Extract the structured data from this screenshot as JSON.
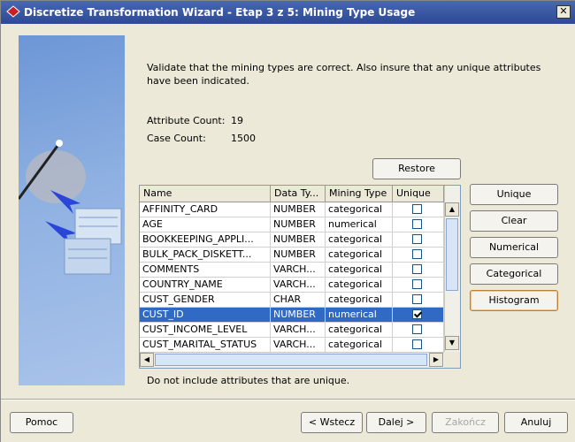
{
  "window": {
    "title": "Discretize Transformation Wizard - Etap 3 z 5: Mining Type Usage",
    "close_glyph": "✕"
  },
  "description": "Validate that the mining types are correct.  Also insure that any unique attributes have been indicated.",
  "counts": {
    "attribute_label": "Attribute Count:",
    "attribute_value": "19",
    "case_label": "Case Count:",
    "case_value": "1500"
  },
  "restore_button": "Restore",
  "table": {
    "columns": [
      "Name",
      "Data Ty...",
      "Mining Type",
      "Unique"
    ],
    "rows": [
      {
        "name": "AFFINITY_CARD",
        "type": "NUMBER",
        "mining": "categorical",
        "unique": false
      },
      {
        "name": "AGE",
        "type": "NUMBER",
        "mining": "numerical",
        "unique": false
      },
      {
        "name": "BOOKKEEPING_APPLI...",
        "type": "NUMBER",
        "mining": "categorical",
        "unique": false
      },
      {
        "name": "BULK_PACK_DISKETT...",
        "type": "NUMBER",
        "mining": "categorical",
        "unique": false
      },
      {
        "name": "COMMENTS",
        "type": "VARCH...",
        "mining": "categorical",
        "unique": false
      },
      {
        "name": "COUNTRY_NAME",
        "type": "VARCH...",
        "mining": "categorical",
        "unique": false
      },
      {
        "name": "CUST_GENDER",
        "type": "CHAR",
        "mining": "categorical",
        "unique": false
      },
      {
        "name": "CUST_ID",
        "type": "NUMBER",
        "mining": "numerical",
        "unique": true,
        "selected": true
      },
      {
        "name": "CUST_INCOME_LEVEL",
        "type": "VARCH...",
        "mining": "categorical",
        "unique": false
      },
      {
        "name": "CUST_MARITAL_STATUS",
        "type": "VARCH...",
        "mining": "categorical",
        "unique": false
      }
    ]
  },
  "side_buttons": {
    "unique": "Unique",
    "clear": "Clear",
    "numerical": "Numerical",
    "categorical": "Categorical",
    "histogram": "Histogram"
  },
  "note": "Do not include attributes that are unique.",
  "footer": {
    "help": "Pomoc",
    "back": "< Wstecz",
    "next": "Dalej >",
    "finish": "Zakończ",
    "cancel": "Anuluj"
  },
  "icons": {
    "app": "wizard-app-icon",
    "scroll_up": "▲",
    "scroll_down": "▼",
    "scroll_left": "◀",
    "scroll_right": "▶"
  },
  "colors": {
    "title_bar": "#2c4a94",
    "selection": "#316ac5",
    "focus_border": "#b5823c"
  }
}
